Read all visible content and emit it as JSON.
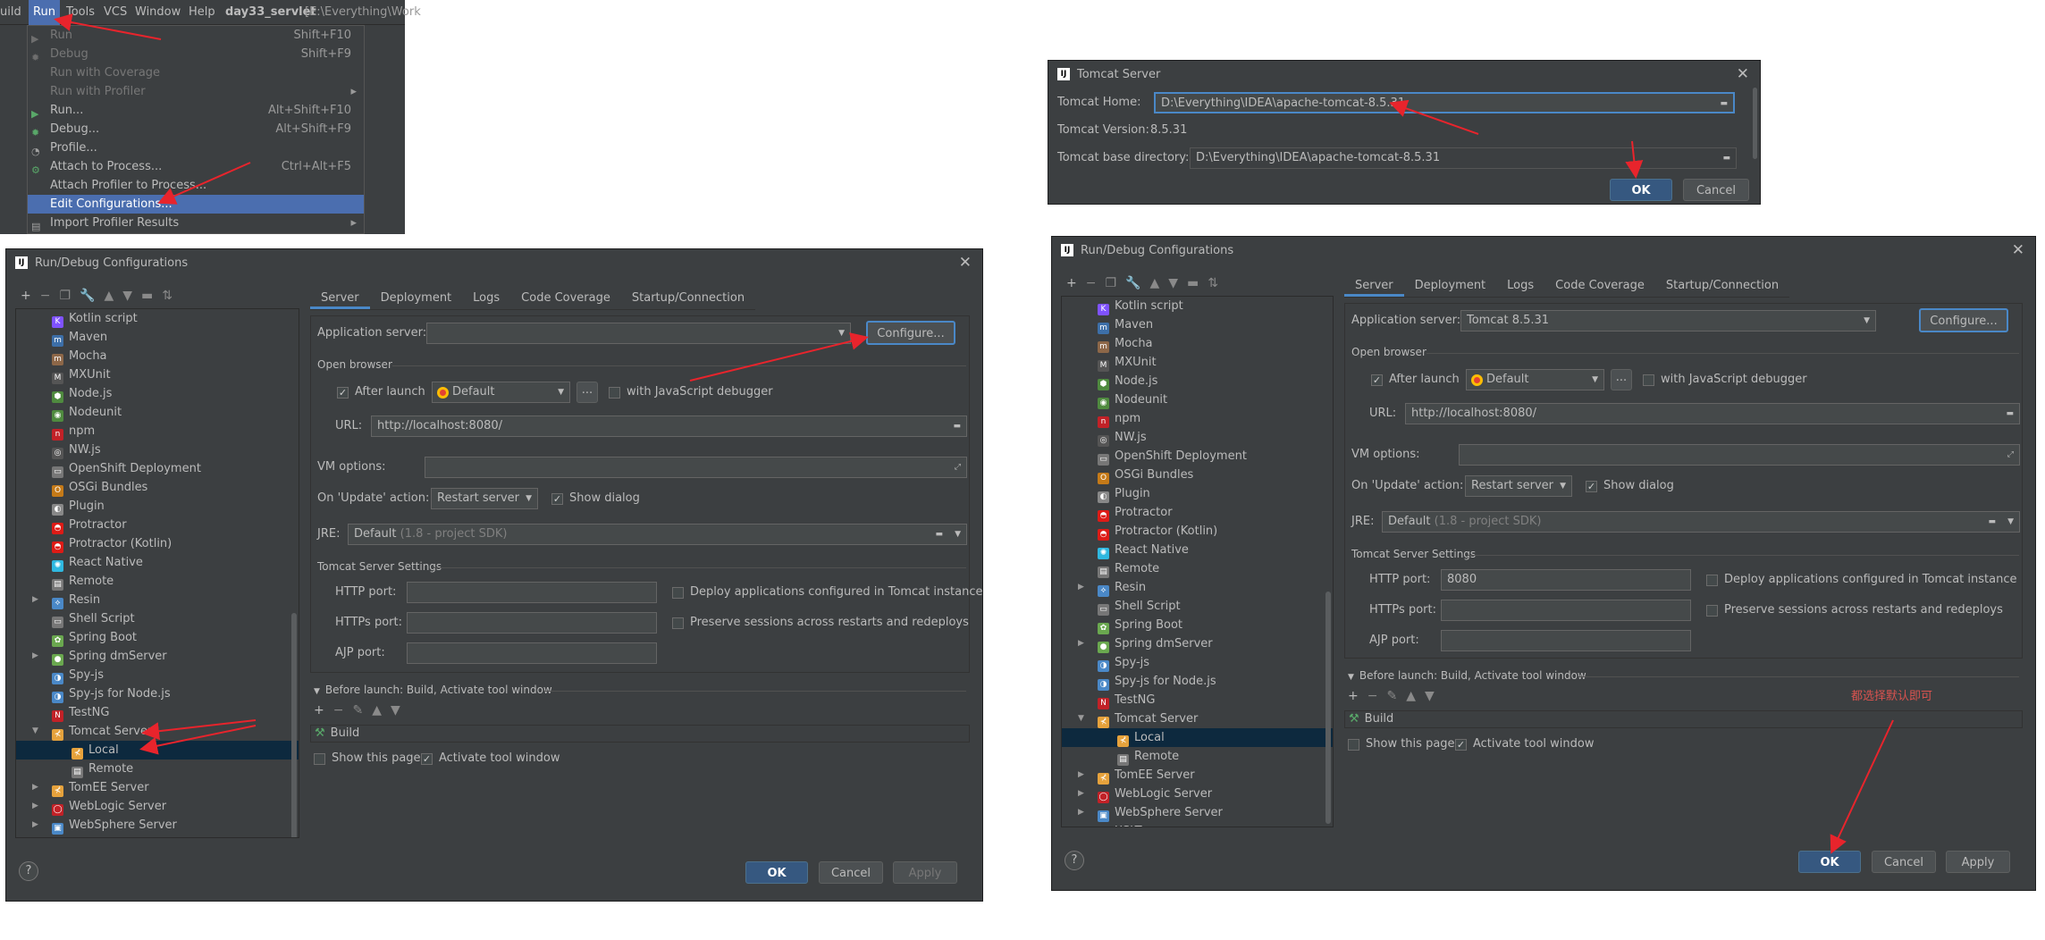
{
  "menubar": {
    "items": [
      "uild",
      "Run",
      "Tools",
      "VCS",
      "Window",
      "Help"
    ],
    "project": "day33_servlet",
    "path": "[E:\\Everything\\Work"
  },
  "run_menu": [
    {
      "label": "Run",
      "shortcut": "Shift+F10",
      "disabled": true
    },
    {
      "label": "Debug",
      "shortcut": "Shift+F9",
      "disabled": true
    },
    {
      "label": "Run with Coverage",
      "shortcut": "",
      "disabled": true
    },
    {
      "label": "Run with Profiler",
      "shortcut": "",
      "disabled": true,
      "submenu": true
    },
    {
      "label": "Run...",
      "shortcut": "Alt+Shift+F10"
    },
    {
      "label": "Debug...",
      "shortcut": "Alt+Shift+F9"
    },
    {
      "label": "Profile...",
      "shortcut": ""
    },
    {
      "label": "Attach to Process...",
      "shortcut": "Ctrl+Alt+F5"
    },
    {
      "label": "Attach Profiler to Process...",
      "shortcut": ""
    },
    {
      "label": "Edit Configurations...",
      "shortcut": "",
      "selected": true
    },
    {
      "label": "Import Profiler Results",
      "shortcut": "",
      "submenu": true
    }
  ],
  "tomcat_dialog": {
    "title": "Tomcat Server",
    "home_label": "Tomcat Home:",
    "home_value": "D:\\Everything\\IDEA\\apache-tomcat-8.5.31",
    "version_label": "Tomcat Version:",
    "version_value": "8.5.31",
    "base_label": "Tomcat base directory:",
    "base_value": "D:\\Everything\\IDEA\\apache-tomcat-8.5.31",
    "ok": "OK",
    "cancel": "Cancel"
  },
  "config": {
    "title": "Run/Debug Configurations",
    "tabs": [
      "Server",
      "Deployment",
      "Logs",
      "Code Coverage",
      "Startup/Connection"
    ],
    "app_server_label": "Application server:",
    "configure": "Configure...",
    "open_browser": "Open browser",
    "after_launch": "After launch",
    "browser": "Default",
    "ellipsis": "...",
    "js_debugger": "with JavaScript debugger",
    "url_label": "URL:",
    "url": "http://localhost:8080/",
    "vm_label": "VM options:",
    "update_label": "On 'Update' action:",
    "update_value": "Restart server",
    "show_dialog": "Show dialog",
    "jre_label": "JRE:",
    "jre_value": "Default",
    "jre_hint": "(1.8 - project SDK)",
    "settings_label": "Tomcat Server Settings",
    "http_label": "HTTP port:",
    "https_label": "HTTPs port:",
    "ajp_label": "AJP port:",
    "deploy_label": "Deploy applications configured in Tomcat instance",
    "preserve_label": "Preserve sessions across restarts and redeploys",
    "before_launch": "Before launch: Build, Activate tool window",
    "build": "Build",
    "show_page": "Show this page",
    "activate": "Activate tool window",
    "ok": "OK",
    "cancel": "Cancel",
    "apply": "Apply",
    "help": "?"
  },
  "left": {
    "app_server": "",
    "http_port": ""
  },
  "right": {
    "app_server": "Tomcat 8.5.31",
    "http_port": "8080"
  },
  "tree_left": [
    "Kotlin script",
    "Maven",
    "Mocha",
    "MXUnit",
    "Node.js",
    "Nodeunit",
    "npm",
    "NW.js",
    "OpenShift Deployment",
    "OSGi Bundles",
    "Plugin",
    "Protractor",
    "Protractor (Kotlin)",
    "React Native",
    "Remote",
    "Resin",
    "Shell Script",
    "Spring Boot",
    "Spring dmServer",
    "Spy-js",
    "Spy-js for Node.js",
    "TestNG",
    "Tomcat Server",
    "Local",
    "Remote",
    "TomEE Server",
    "WebLogic Server",
    "WebSphere Server",
    "XSLT"
  ],
  "annotation": "都选择默认即可",
  "icon_colors": {
    "accent": "#4a88c7",
    "selection": "#0d293e",
    "menu_selection": "#4b6eaf",
    "arrow": "#e8242c"
  }
}
